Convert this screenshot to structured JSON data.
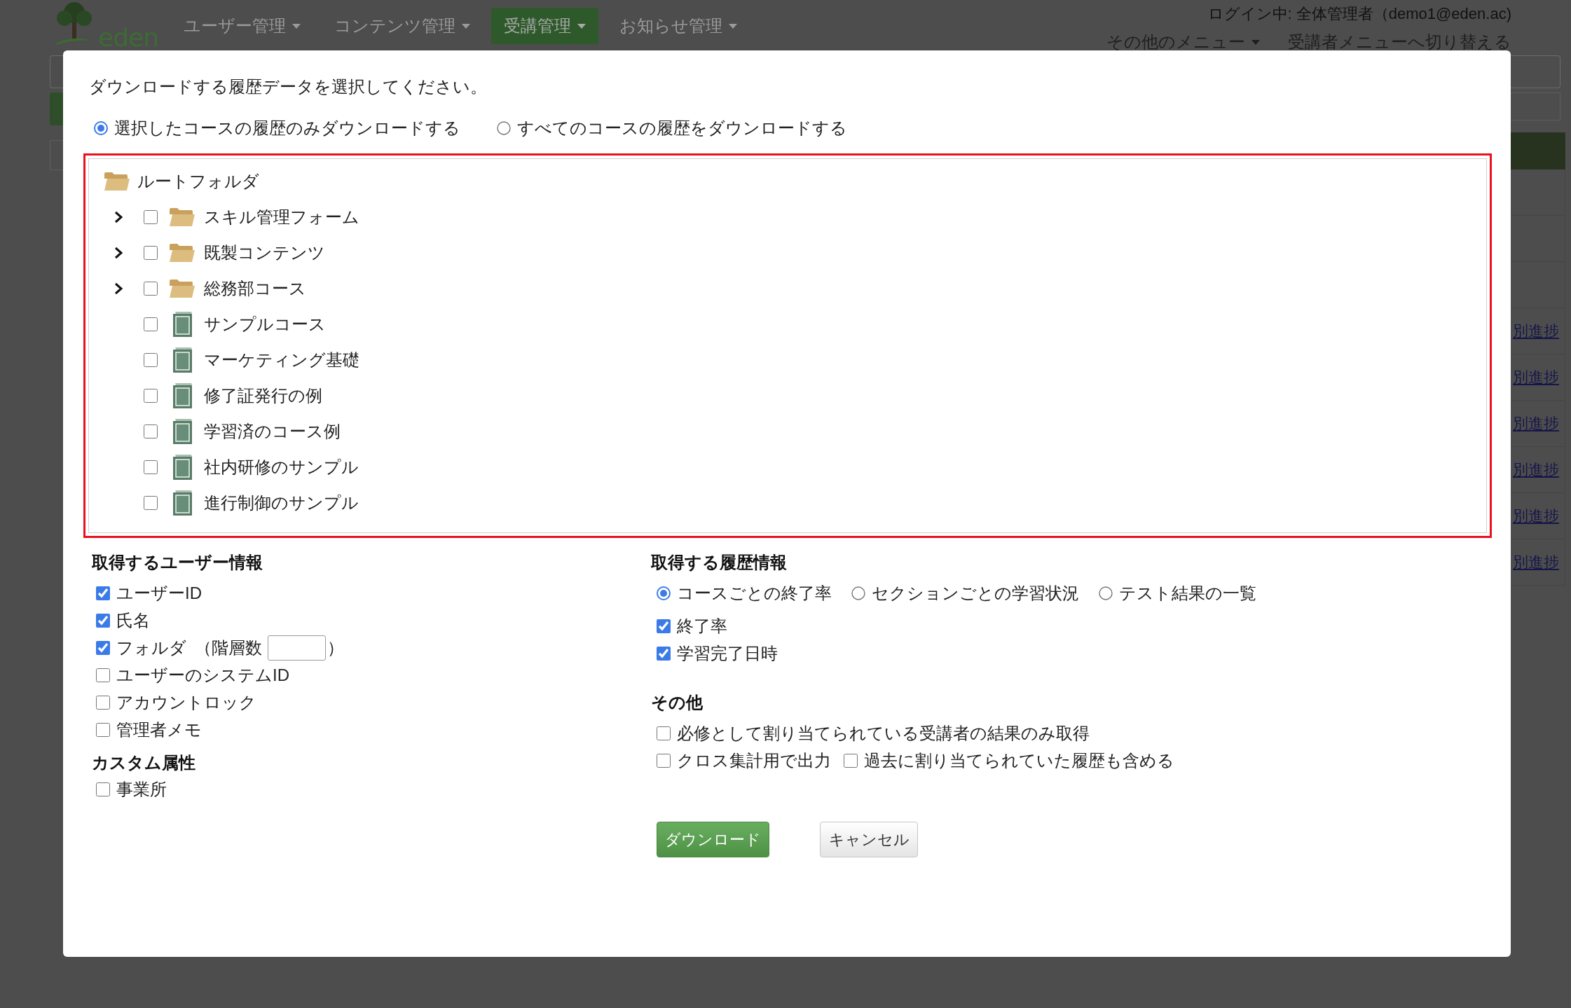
{
  "background_page": {
    "logo": {
      "text": "eden"
    },
    "nav": [
      {
        "label": "ユーザー管理",
        "selected": false
      },
      {
        "label": "コンテンツ管理",
        "selected": false
      },
      {
        "label": "受講管理",
        "selected": true
      },
      {
        "label": "お知らせ管理",
        "selected": false
      }
    ],
    "login_status": "ログイン中: 全体管理者（demo1@eden.ac)",
    "header_links": [
      {
        "label": "その他のメニュー",
        "kind": "dropdown"
      },
      {
        "label": "受講者メニューへ切り替える",
        "kind": "link"
      }
    ],
    "table_links": [
      "別進捗",
      "別進捗",
      "別進捗",
      "別進捗",
      "別進捗",
      "別進捗"
    ]
  },
  "dialog": {
    "instruction": "ダウンロードする履歴データを選択してください。",
    "scope_options": [
      {
        "label": "選択したコースの履歴のみダウンロードする",
        "selected": true
      },
      {
        "label": "すべてのコースの履歴をダウンロードする",
        "selected": false
      }
    ],
    "tree": {
      "label": "ルートフォルダ",
      "children": [
        {
          "label": "スキル管理フォーム",
          "kind": "folder",
          "expanded": false,
          "checked": false
        },
        {
          "label": "既製コンテンツ",
          "kind": "folder",
          "expanded": false,
          "checked": false
        },
        {
          "label": "総務部コース",
          "kind": "folder",
          "expanded": false,
          "checked": false
        },
        {
          "label": "サンプルコース",
          "kind": "course",
          "checked": false
        },
        {
          "label": "マーケティング基礎",
          "kind": "course",
          "checked": false
        },
        {
          "label": "修了証発行の例",
          "kind": "course",
          "checked": false
        },
        {
          "label": "学習済のコース例",
          "kind": "course",
          "checked": false
        },
        {
          "label": "社内研修のサンプル",
          "kind": "course",
          "checked": false
        },
        {
          "label": "進行制御のサンプル",
          "kind": "course",
          "checked": false
        }
      ]
    },
    "user_info": {
      "heading": "取得するユーザー情報",
      "options": [
        {
          "label": "ユーザーID",
          "kind": "plain",
          "checked": true
        },
        {
          "label": "氏名",
          "kind": "plain",
          "checked": true
        },
        {
          "label": "フォルダ",
          "kind": "depth",
          "checked": true,
          "depth_label": "（階層数",
          "depth_close": "）"
        },
        {
          "label": "ユーザーのシステムID",
          "kind": "plain",
          "checked": false
        },
        {
          "label": "アカウントロック",
          "kind": "plain",
          "checked": false
        },
        {
          "label": "管理者メモ",
          "kind": "plain",
          "checked": false
        }
      ]
    },
    "custom_attributes": {
      "heading": "カスタム属性",
      "options": [
        {
          "label": "事業所",
          "checked": false
        }
      ]
    },
    "history_info": {
      "heading": "取得する履歴情報",
      "modes": [
        {
          "label": "コースごとの終了率",
          "selected": true
        },
        {
          "label": "セクションごとの学習状況",
          "selected": false
        },
        {
          "label": "テスト結果の一覧",
          "selected": false
        }
      ],
      "fields": [
        {
          "label": "終了率",
          "checked": true
        },
        {
          "label": "学習完了日時",
          "checked": true
        }
      ]
    },
    "other": {
      "heading": "その他",
      "rows": [
        [
          {
            "label": "必修として割り当てられている受講者の結果のみ取得",
            "checked": false
          }
        ],
        [
          {
            "label": "クロス集計用で出力",
            "checked": false
          },
          {
            "label": "過去に割り当てられていた履歴も含める",
            "checked": false
          }
        ]
      ]
    },
    "buttons": [
      {
        "label": "ダウンロード",
        "kind": "primary"
      },
      {
        "label": "キャンセル",
        "kind": "default"
      }
    ]
  }
}
